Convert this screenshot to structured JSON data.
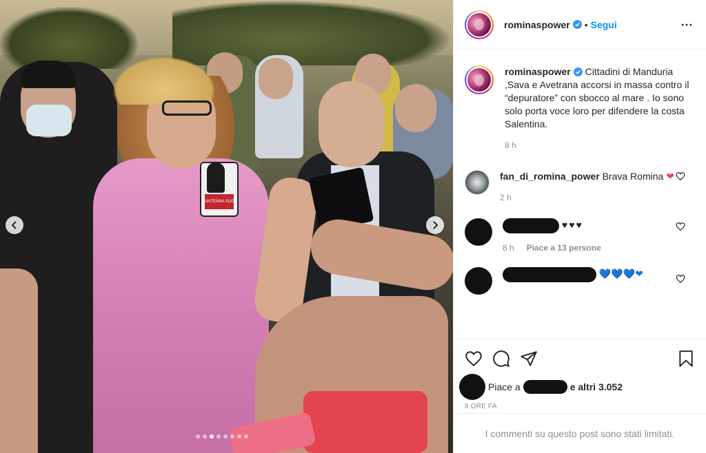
{
  "post": {
    "username": "rominaspower",
    "separator": "•",
    "follow_label": "Segui",
    "caption": "Cittadini di Manduria ,Sava e Avetrana accorsi in massa contro il “depuratore” con sbocco al mare . Io sono solo porta voce loro per difendere la costa Salentina.",
    "caption_time": "8 h",
    "carousel": {
      "current_index": 2,
      "total": 8
    },
    "mic_badge": "ANTENNA SUD 85"
  },
  "comments": [
    {
      "username": "fan_di_romina_power",
      "text": "Brava Romina",
      "emoji": "❤",
      "time": "2 h"
    },
    {
      "username": "",
      "text": "♥♥♥",
      "time": "8 h",
      "likes": "Piace a 13 persone"
    },
    {
      "username": "",
      "text": "💙💙💙❤",
      "emoji": "❤"
    }
  ],
  "likes": {
    "prefix": "Piace a",
    "suffix": "e altri 3.052"
  },
  "post_time": "8 ORE FA",
  "comments_limited": "I commenti su questo post sono stati limitati.",
  "colors": {
    "accent": "#0095f6",
    "muted": "#8e8e8e",
    "text": "#262626",
    "heart_red": "#ed4956",
    "heart_blue": "#1877f2"
  },
  "icons": [
    "verified-icon",
    "more-icon",
    "heart-icon",
    "comment-icon",
    "share-icon",
    "bookmark-icon",
    "chevron-left-icon",
    "chevron-right-icon"
  ]
}
